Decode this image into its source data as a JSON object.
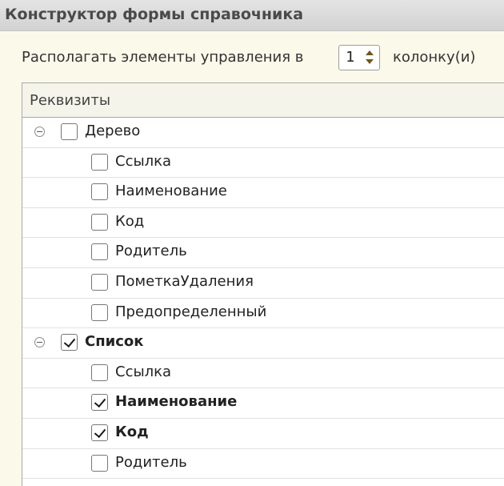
{
  "window": {
    "title": "Конструктор формы справочника"
  },
  "columns": {
    "prefix_label": "Располагать элементы управления в",
    "count": "1",
    "suffix_label": "колонку(и)"
  },
  "table": {
    "header": "Реквизиты",
    "rows": [
      {
        "label": "Дерево",
        "level": 0,
        "checked": false,
        "bold": false,
        "expanded": true
      },
      {
        "label": "Ссылка",
        "level": 1,
        "checked": false,
        "bold": false
      },
      {
        "label": "Наименование",
        "level": 1,
        "checked": false,
        "bold": false
      },
      {
        "label": "Код",
        "level": 1,
        "checked": false,
        "bold": false
      },
      {
        "label": "Родитель",
        "level": 1,
        "checked": false,
        "bold": false
      },
      {
        "label": "ПометкаУдаления",
        "level": 1,
        "checked": false,
        "bold": false
      },
      {
        "label": "Предопределенный",
        "level": 1,
        "checked": false,
        "bold": false
      },
      {
        "label": "Список",
        "level": 0,
        "checked": true,
        "bold": true,
        "expanded": true
      },
      {
        "label": "Ссылка",
        "level": 1,
        "checked": false,
        "bold": false
      },
      {
        "label": "Наименование",
        "level": 1,
        "checked": true,
        "bold": true
      },
      {
        "label": "Код",
        "level": 1,
        "checked": true,
        "bold": true
      },
      {
        "label": "Родитель",
        "level": 1,
        "checked": false,
        "bold": false
      }
    ]
  }
}
